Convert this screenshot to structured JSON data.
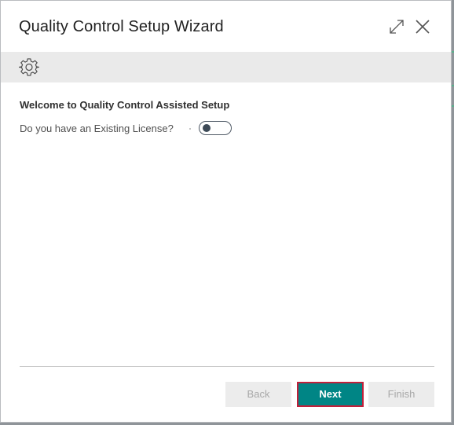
{
  "dialog": {
    "title": "Quality Control Setup Wizard"
  },
  "icons": {
    "expand": "expand-icon",
    "close": "close-icon",
    "settings": "gear-icon"
  },
  "content": {
    "heading": "Welcome to Quality Control Assisted Setup",
    "license_label": "Do you have an Existing License?",
    "license_toggle_on": false
  },
  "footer": {
    "back_label": "Back",
    "next_label": "Next",
    "finish_label": "Finish",
    "back_enabled": false,
    "finish_enabled": false
  },
  "colors": {
    "primary": "#008585",
    "focus_border": "#c0203a",
    "toolbar_bg": "#eaeaea"
  }
}
